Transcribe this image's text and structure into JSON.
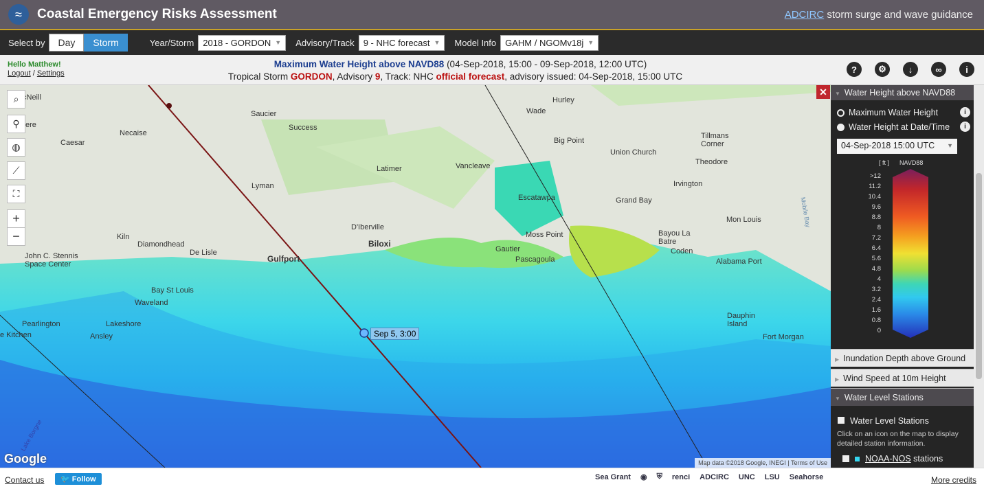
{
  "header": {
    "title": "Coastal Emergency Risks Assessment",
    "link_text": "ADCIRC",
    "link_suffix": " storm surge and wave guidance"
  },
  "toolbar": {
    "select_by_label": "Select by",
    "day_label": "Day",
    "storm_label": "Storm",
    "year_storm_label": "Year/Storm",
    "year_storm_value": "2018 - GORDON",
    "advisory_label": "Advisory/Track",
    "advisory_value": "9 - NHC forecast",
    "model_label": "Model Info",
    "model_value": "GAHM / NGOMv18j"
  },
  "info": {
    "hello": "Hello Matthew!",
    "logout": "Logout",
    "separator": "/",
    "settings": "Settings",
    "line1_product": "Maximum Water Height above NAVD88",
    "line1_range": " (04-Sep-2018, 15:00 - 09-Sep-2018, 12:00 UTC)",
    "line2_a": "Tropical Storm ",
    "line2_storm": "GORDON",
    "line2_b": ", Advisory ",
    "line2_adv": "9",
    "line2_c": ", Track: NHC ",
    "line2_official": "official forecast",
    "line2_d": ", advisory issued: 04-Sep-2018, 15:00 UTC"
  },
  "map": {
    "track_tooltip": "Sep 5, 3:00",
    "attribution": "Map data ©2018 Google, INEGI",
    "terms": "Terms of Use",
    "google": "Google",
    "places": [
      "Saucier",
      "Success",
      "Necaise",
      "Caesar",
      "Latimer",
      "Vancleave",
      "Wade",
      "Hurley",
      "Big Point",
      "Union Church",
      "Tillmans Corner",
      "Theodore",
      "Irvington",
      "Lyman",
      "Escatawpa",
      "Grand Bay",
      "Mon Louis",
      "D'Iberville",
      "Biloxi",
      "Gulfport",
      "Moss Point",
      "Gautier",
      "Pascagoula",
      "Kiln",
      "Diamondhead",
      "De Lisle",
      "Bayou La Batre",
      "Coden",
      "Alabama Port",
      "John C. Stennis Space Center",
      "Bay St Louis",
      "Waveland",
      "Pearlington",
      "Lakeshore",
      "Ansley",
      "Dauphin Island",
      "Fort Morgan",
      "Mobile Bay",
      "Lake Borgne",
      "cNeill",
      "ere",
      "e Kitchen"
    ]
  },
  "panel": {
    "water_header": "Water Height above NAVD88",
    "opt_max": "Maximum Water Height",
    "opt_date": "Water Height at Date/Time",
    "datetime": "04-Sep-2018 15:00 UTC",
    "legend_unit": "[ ft ]",
    "legend_datum": "NAVD88",
    "legend_labels": [
      ">12",
      "11.2",
      "10.4",
      "9.6",
      "8.8",
      "8",
      "7.2",
      "6.4",
      "5.6",
      "4.8",
      "4",
      "3.2",
      "2.4",
      "1.6",
      "0.8",
      "0"
    ],
    "inundation": "Inundation Depth above Ground",
    "wind": "Wind Speed at 10m Height",
    "stations_header": "Water Level Stations",
    "stations_check": "Water Level Stations",
    "stations_desc": "Click on an icon on the map to display detailed station information.",
    "noaa": "NOAA-NOS",
    "noaa_suffix": " stations"
  },
  "footer": {
    "contact": "Contact us",
    "follow": "Follow",
    "more": "More credits",
    "partners": [
      "Sea Grant",
      "renci",
      "ADCIRC",
      "UNC",
      "LSU",
      "Seahorse"
    ]
  }
}
